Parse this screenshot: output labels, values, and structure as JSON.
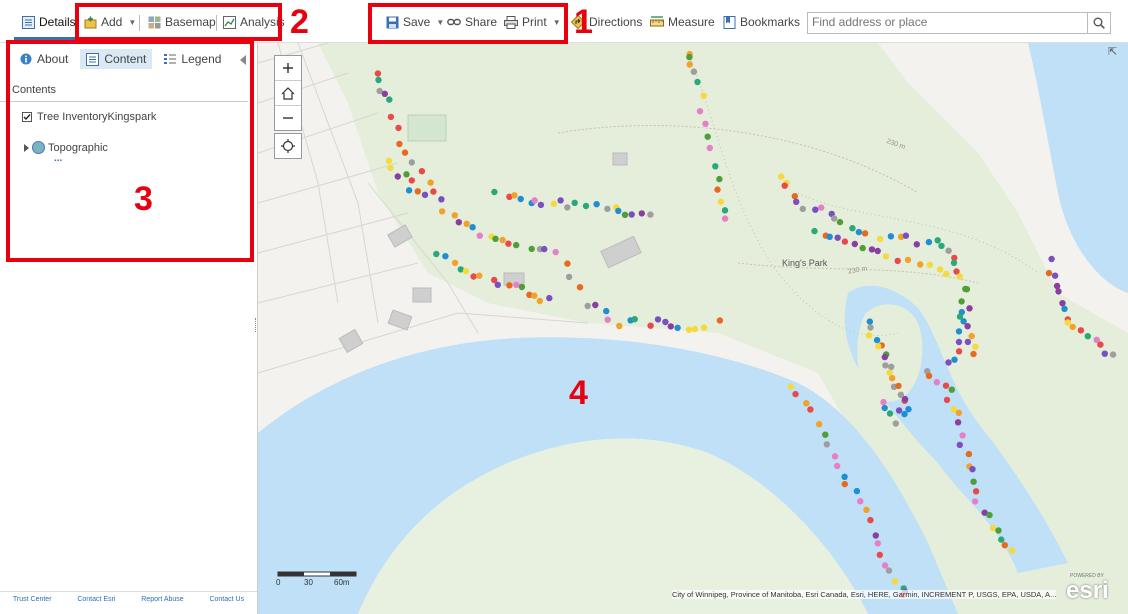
{
  "toolbar": {
    "details": "Details",
    "add": "Add",
    "basemap": "Basemap",
    "analysis": "Analysis",
    "save": "Save",
    "share": "Share",
    "print": "Print",
    "directions": "Directions",
    "measure": "Measure",
    "bookmarks": "Bookmarks",
    "search_placeholder": "Find address or place"
  },
  "annotations": [
    "1",
    "2",
    "3",
    "4"
  ],
  "sidebar": {
    "tabs": [
      {
        "label": "About",
        "icon": "info-icon"
      },
      {
        "label": "Content",
        "icon": "content-icon",
        "active": true
      },
      {
        "label": "Legend",
        "icon": "legend-icon"
      }
    ],
    "contents_heading": "Contents",
    "layers": [
      {
        "label": "Tree InventoryKingspark",
        "checked": true
      },
      {
        "label": "Topographic",
        "icon": "basemap-globe-icon"
      }
    ],
    "more": "...",
    "footer_links": [
      "Trust Center",
      "Contact Esri",
      "Report Abuse",
      "Contact Us"
    ]
  },
  "map": {
    "place_label": "King's Park",
    "contour_labels": [
      "230 m",
      "230 m"
    ],
    "scale_labels": [
      "0",
      "30",
      "60m"
    ],
    "attribution": "City of Winnipeg, Province of Manitoba, Esri Canada, Esri, HERE, Garmin, INCREMENT P, USGS, EPA, USDA, A...",
    "powered_by": "POWERED BY",
    "logo_text": "esri",
    "colors": {
      "water": "#bfe0f6",
      "park": "#e4eedb",
      "land": "#f3f2ee",
      "annotation_red": "#e8000f"
    },
    "point_colors": [
      "#1f8fd1",
      "#e84a4a",
      "#f3a12a",
      "#7a4fbf",
      "#f6d93a",
      "#2aa87a",
      "#9e9e9e",
      "#e67fc8",
      "#8a3fa0",
      "#4f9e3a",
      "#e86a20"
    ]
  }
}
